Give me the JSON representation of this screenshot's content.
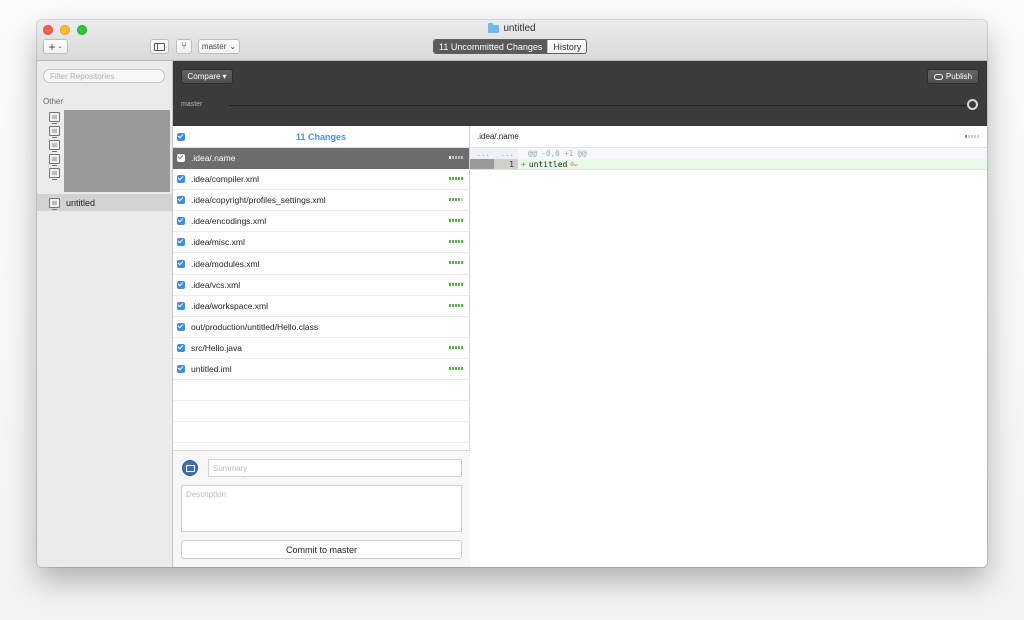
{
  "window": {
    "title": "untitled",
    "add_label": "+",
    "add_chevron": "⌄",
    "branch_glyph": "⑂",
    "branch_label": "master",
    "branch_chevron": "⌄",
    "tabs": [
      {
        "label": "11 Uncommitted Changes",
        "active": true
      },
      {
        "label": "History",
        "active": false
      }
    ]
  },
  "sidebar": {
    "filter_placeholder": "Filter Repositories",
    "group_label": "Other",
    "selected_repo": "untitled"
  },
  "toolbar": {
    "compare_label": "Compare",
    "compare_chevron": "▾",
    "publish_label": "Publish",
    "timeline_branch": "master"
  },
  "changes": {
    "header": "11 Changes",
    "files": [
      {
        "name": ".idea/.name",
        "selected": true,
        "stat": [
          1,
          0,
          0,
          0,
          0
        ]
      },
      {
        "name": ".idea/compiler.xml",
        "selected": false,
        "stat": [
          1,
          1,
          1,
          1,
          1
        ]
      },
      {
        "name": ".idea/copyright/profiles_settings.xml",
        "selected": false,
        "stat": [
          1,
          1,
          1,
          1,
          0
        ]
      },
      {
        "name": ".idea/encodings.xml",
        "selected": false,
        "stat": [
          1,
          1,
          1,
          1,
          1
        ]
      },
      {
        "name": ".idea/misc.xml",
        "selected": false,
        "stat": [
          1,
          1,
          1,
          1,
          1
        ]
      },
      {
        "name": ".idea/modules.xml",
        "selected": false,
        "stat": [
          1,
          1,
          1,
          1,
          1
        ]
      },
      {
        "name": ".idea/vcs.xml",
        "selected": false,
        "stat": [
          1,
          1,
          1,
          1,
          1
        ]
      },
      {
        "name": ".idea/workspace.xml",
        "selected": false,
        "stat": [
          1,
          1,
          1,
          1,
          1
        ]
      },
      {
        "name": "out/production/untitled/Hello.class",
        "selected": false,
        "stat": []
      },
      {
        "name": "src/Hello.java",
        "selected": false,
        "stat": [
          1,
          1,
          1,
          1,
          1
        ]
      },
      {
        "name": "untitled.iml",
        "selected": false,
        "stat": [
          1,
          1,
          1,
          1,
          1
        ]
      }
    ]
  },
  "commit": {
    "summary_placeholder": "Summary",
    "description_placeholder": "Description",
    "button_label": "Commit to master"
  },
  "diff": {
    "file": ".idea/.name",
    "stat": [
      1,
      0,
      0,
      0,
      0
    ],
    "hunk_old_ln": "...",
    "hunk_new_ln": "...",
    "hunk_header": "@@ -0,0 +1 @@",
    "line_new_ln": "1",
    "line_sign": "+",
    "line_text": "untitled",
    "no_newline_glyph": "⊘↵"
  },
  "colors": {
    "accent": "#4a90d9",
    "added": "#57b447",
    "dark_toolbar": "#3b3b3b"
  }
}
